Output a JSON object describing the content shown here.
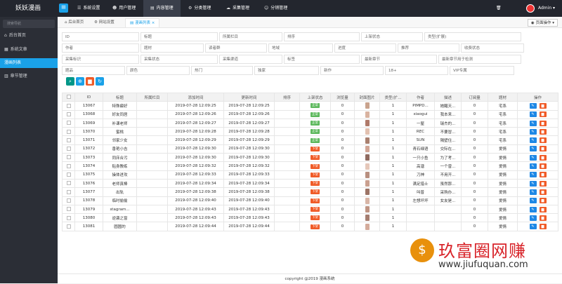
{
  "app": {
    "title": "妖妖漫画"
  },
  "topnav": [
    {
      "label": "系统设置",
      "icon": "list-icon"
    },
    {
      "label": "用户管理",
      "icon": "user-icon"
    },
    {
      "label": "内容管理",
      "icon": "doc-icon"
    },
    {
      "label": "分类管理",
      "icon": "settings-icon"
    },
    {
      "label": "采集管理",
      "icon": "cloud-icon"
    },
    {
      "label": "分销管理",
      "icon": "people-icon"
    }
  ],
  "topright": {
    "user": "Admin",
    "caret": "▾"
  },
  "sidebar": {
    "search_placeholder": "搜索导航",
    "items": [
      {
        "label": "后台首页"
      },
      {
        "label": "系统文章"
      },
      {
        "label": "漫画列表"
      },
      {
        "label": "章节管理"
      }
    ]
  },
  "tabs": [
    {
      "label": "后台首页"
    },
    {
      "label": "网站设置"
    },
    {
      "label": "漫画列表",
      "close": "×"
    }
  ],
  "page_op": "页面操作",
  "filters": {
    "row1": [
      "ID",
      "标题",
      "所属栏目",
      "排序",
      "上架状态",
      "类型(扩展)"
    ],
    "row2": [
      "作者",
      "题材",
      "读者群",
      "地域",
      "进度",
      "推荐",
      "收费状态"
    ],
    "row3": [
      "采集标识",
      "采集状态",
      "采集渠道",
      "标签",
      "最新章节",
      "最新章节用于检测"
    ],
    "row4": [
      "题品",
      "颜色",
      "热门",
      "独家",
      "新作",
      "18+",
      "VIP专属"
    ]
  },
  "table": {
    "headers": [
      "ID",
      "标题",
      "所属栏目",
      "添加时间",
      "更新时间",
      "排序",
      "上架状态",
      "浏览量",
      "封面图片",
      "类型(扩...",
      "作者",
      "描述",
      "订阅量",
      "题材",
      "操作"
    ],
    "rows": [
      {
        "id": "13067",
        "title": "特殊癖好",
        "add": "2019-07-28 12:09:25",
        "upd": "2019-07-28 12:09:25",
        "status": "正常",
        "views": "0",
        "type": "1",
        "author": "PIMPD...",
        "desc": "她醒天...",
        "sub": "0",
        "genre": "宅系"
      },
      {
        "id": "13068",
        "title": "好友同居",
        "add": "2019-07-28 12:09:26",
        "upd": "2019-07-28 12:09:26",
        "status": "正常",
        "views": "0",
        "type": "1",
        "author": "xiaogui",
        "desc": "我本来...",
        "sub": "0",
        "genre": "宅系"
      },
      {
        "id": "13069",
        "title": "补课老师",
        "add": "2019-07-28 12:09:27",
        "upd": "2019-07-28 12:09:27",
        "status": "正常",
        "views": "0",
        "type": "1",
        "author": "一屋",
        "desc": "瑞杰的...",
        "sub": "0",
        "genre": "宅系"
      },
      {
        "id": "13070",
        "title": "蜜桃",
        "add": "2019-07-28 12:09:28",
        "upd": "2019-07-28 12:09:28",
        "status": "正常",
        "views": "0",
        "type": "1",
        "author": "REC",
        "desc": "不要冒...",
        "sub": "0",
        "genre": "宅系"
      },
      {
        "id": "13071",
        "title": "邻家少女",
        "add": "2019-07-28 12:09:29",
        "upd": "2019-07-28 12:09:29",
        "status": "正常",
        "views": "0",
        "type": "1",
        "author": "SUN",
        "desc": "隔壁住...",
        "sub": "0",
        "genre": "宅系"
      },
      {
        "id": "13072",
        "title": "香艳小吉",
        "add": "2019-07-28 12:09:30",
        "upd": "2019-07-28 12:09:30",
        "status": "下架",
        "views": "0",
        "type": "1",
        "author": "青石细语",
        "desc": "交际在...",
        "sub": "0",
        "genre": "爱情"
      },
      {
        "id": "13073",
        "title": "同床合污",
        "add": "2019-07-28 12:09:30",
        "upd": "2019-07-28 12:09:30",
        "status": "下架",
        "views": "0",
        "type": "1",
        "author": "一只小鱼",
        "desc": "为了考...",
        "sub": "0",
        "genre": "爱情"
      },
      {
        "id": "13074",
        "title": "贴身教练",
        "add": "2019-07-28 12:09:32",
        "upd": "2019-07-28 12:09:32",
        "status": "下架",
        "views": "0",
        "type": "1",
        "author": "高溏",
        "desc": "一个曾...",
        "sub": "0",
        "genre": "爱情"
      },
      {
        "id": "13075",
        "title": "操体进攻",
        "add": "2019-07-28 12:09:33",
        "upd": "2019-07-28 12:09:33",
        "status": "下架",
        "views": "0",
        "type": "1",
        "author": "刀神",
        "desc": "不用开...",
        "sub": "0",
        "genre": "爱情"
      },
      {
        "id": "13076",
        "title": "老师真棒",
        "add": "2019-07-28 12:09:34",
        "upd": "2019-07-28 12:09:34",
        "status": "下架",
        "views": "0",
        "type": "1",
        "author": "满足猎士",
        "desc": "虽然那...",
        "sub": "0",
        "genre": "爱情"
      },
      {
        "id": "13077",
        "title": "出轨",
        "add": "2019-07-28 12:09:38",
        "upd": "2019-07-28 12:09:38",
        "status": "下架",
        "views": "0",
        "type": "1",
        "author": "叫普",
        "desc": "采购办...",
        "sub": "0",
        "genre": "爱情"
      },
      {
        "id": "13078",
        "title": "临时偷偷",
        "add": "2019-07-28 12:09:40",
        "upd": "2019-07-28 12:09:40",
        "status": "下架",
        "views": "0",
        "type": "1",
        "author": "左想坏坏",
        "desc": "女友是...",
        "sub": "0",
        "genre": "爱情"
      },
      {
        "id": "13079",
        "title": "stagram...",
        "add": "2019-07-28 12:09:43",
        "upd": "2019-07-28 12:09:43",
        "status": "下架",
        "views": "0",
        "type": "1",
        "author": "",
        "desc": "",
        "sub": "0",
        "genre": "爱情"
      },
      {
        "id": "13080",
        "title": "逆袭之窗",
        "add": "2019-07-28 12:09:43",
        "upd": "2019-07-28 12:09:43",
        "status": "下架",
        "views": "0",
        "type": "1",
        "author": "",
        "desc": "",
        "sub": "0",
        "genre": "爱情"
      },
      {
        "id": "13081",
        "title": "圆圆的",
        "add": "2019-07-28 12:09:44",
        "upd": "2019-07-28 12:09:44",
        "status": "下架",
        "views": "0",
        "type": "1",
        "author": "",
        "desc": "",
        "sub": "0",
        "genre": "爱情"
      }
    ]
  },
  "footer": "copyright @2019 漫画系统",
  "watermark": {
    "text": "玖富圈网赚",
    "url": "www.jiufuquan.com",
    "coin": "$"
  },
  "colors": {
    "accent": "#1aa1e8",
    "ok": "#5cb85c",
    "off": "#f05b27",
    "edit": "#1e88e5",
    "del": "#f05b27",
    "search": "#009688"
  }
}
